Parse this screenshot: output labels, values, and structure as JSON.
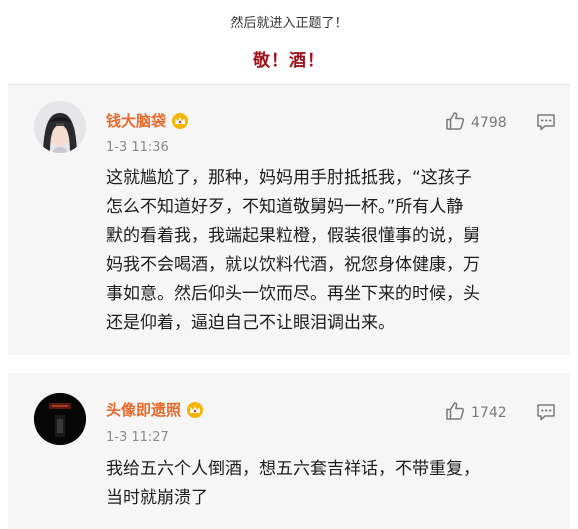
{
  "caption": "然后就进入正题了！",
  "title": "敬！酒！",
  "comments": [
    {
      "username": "钱大脑袋",
      "time": "1-3 11:36",
      "likes": "4798",
      "lines": [
        "这就尴尬了，那种，妈妈用手肘抵抵我，“这孩子",
        "怎么不知道好歹，不知道敬舅妈一杯。”所有人静",
        "默的看着我，我端起果粒橙，假装很懂事的说，舅",
        "妈我不会喝酒，就以饮料代酒，祝您身体健康，万",
        "事如意。然后仰头一饮而尽。再坐下来的时候，头",
        "还是仰着，逼迫自己不让眼泪调出来。"
      ]
    },
    {
      "username": "头像即遗照",
      "time": "1-3 11:27",
      "likes": "1742",
      "lines": [
        "我给五六个人倒酒，想五六套吉祥话，不带重复，",
        "当时就崩溃了"
      ]
    }
  ],
  "colors": {
    "title": "#a0121a",
    "username": "#e76a2a",
    "meta": "#8a8a8a",
    "comment_bg": "#f6f6f6"
  },
  "icons": [
    "crown-badge-icon",
    "thumbs-up-icon",
    "comment-reply-icon"
  ]
}
